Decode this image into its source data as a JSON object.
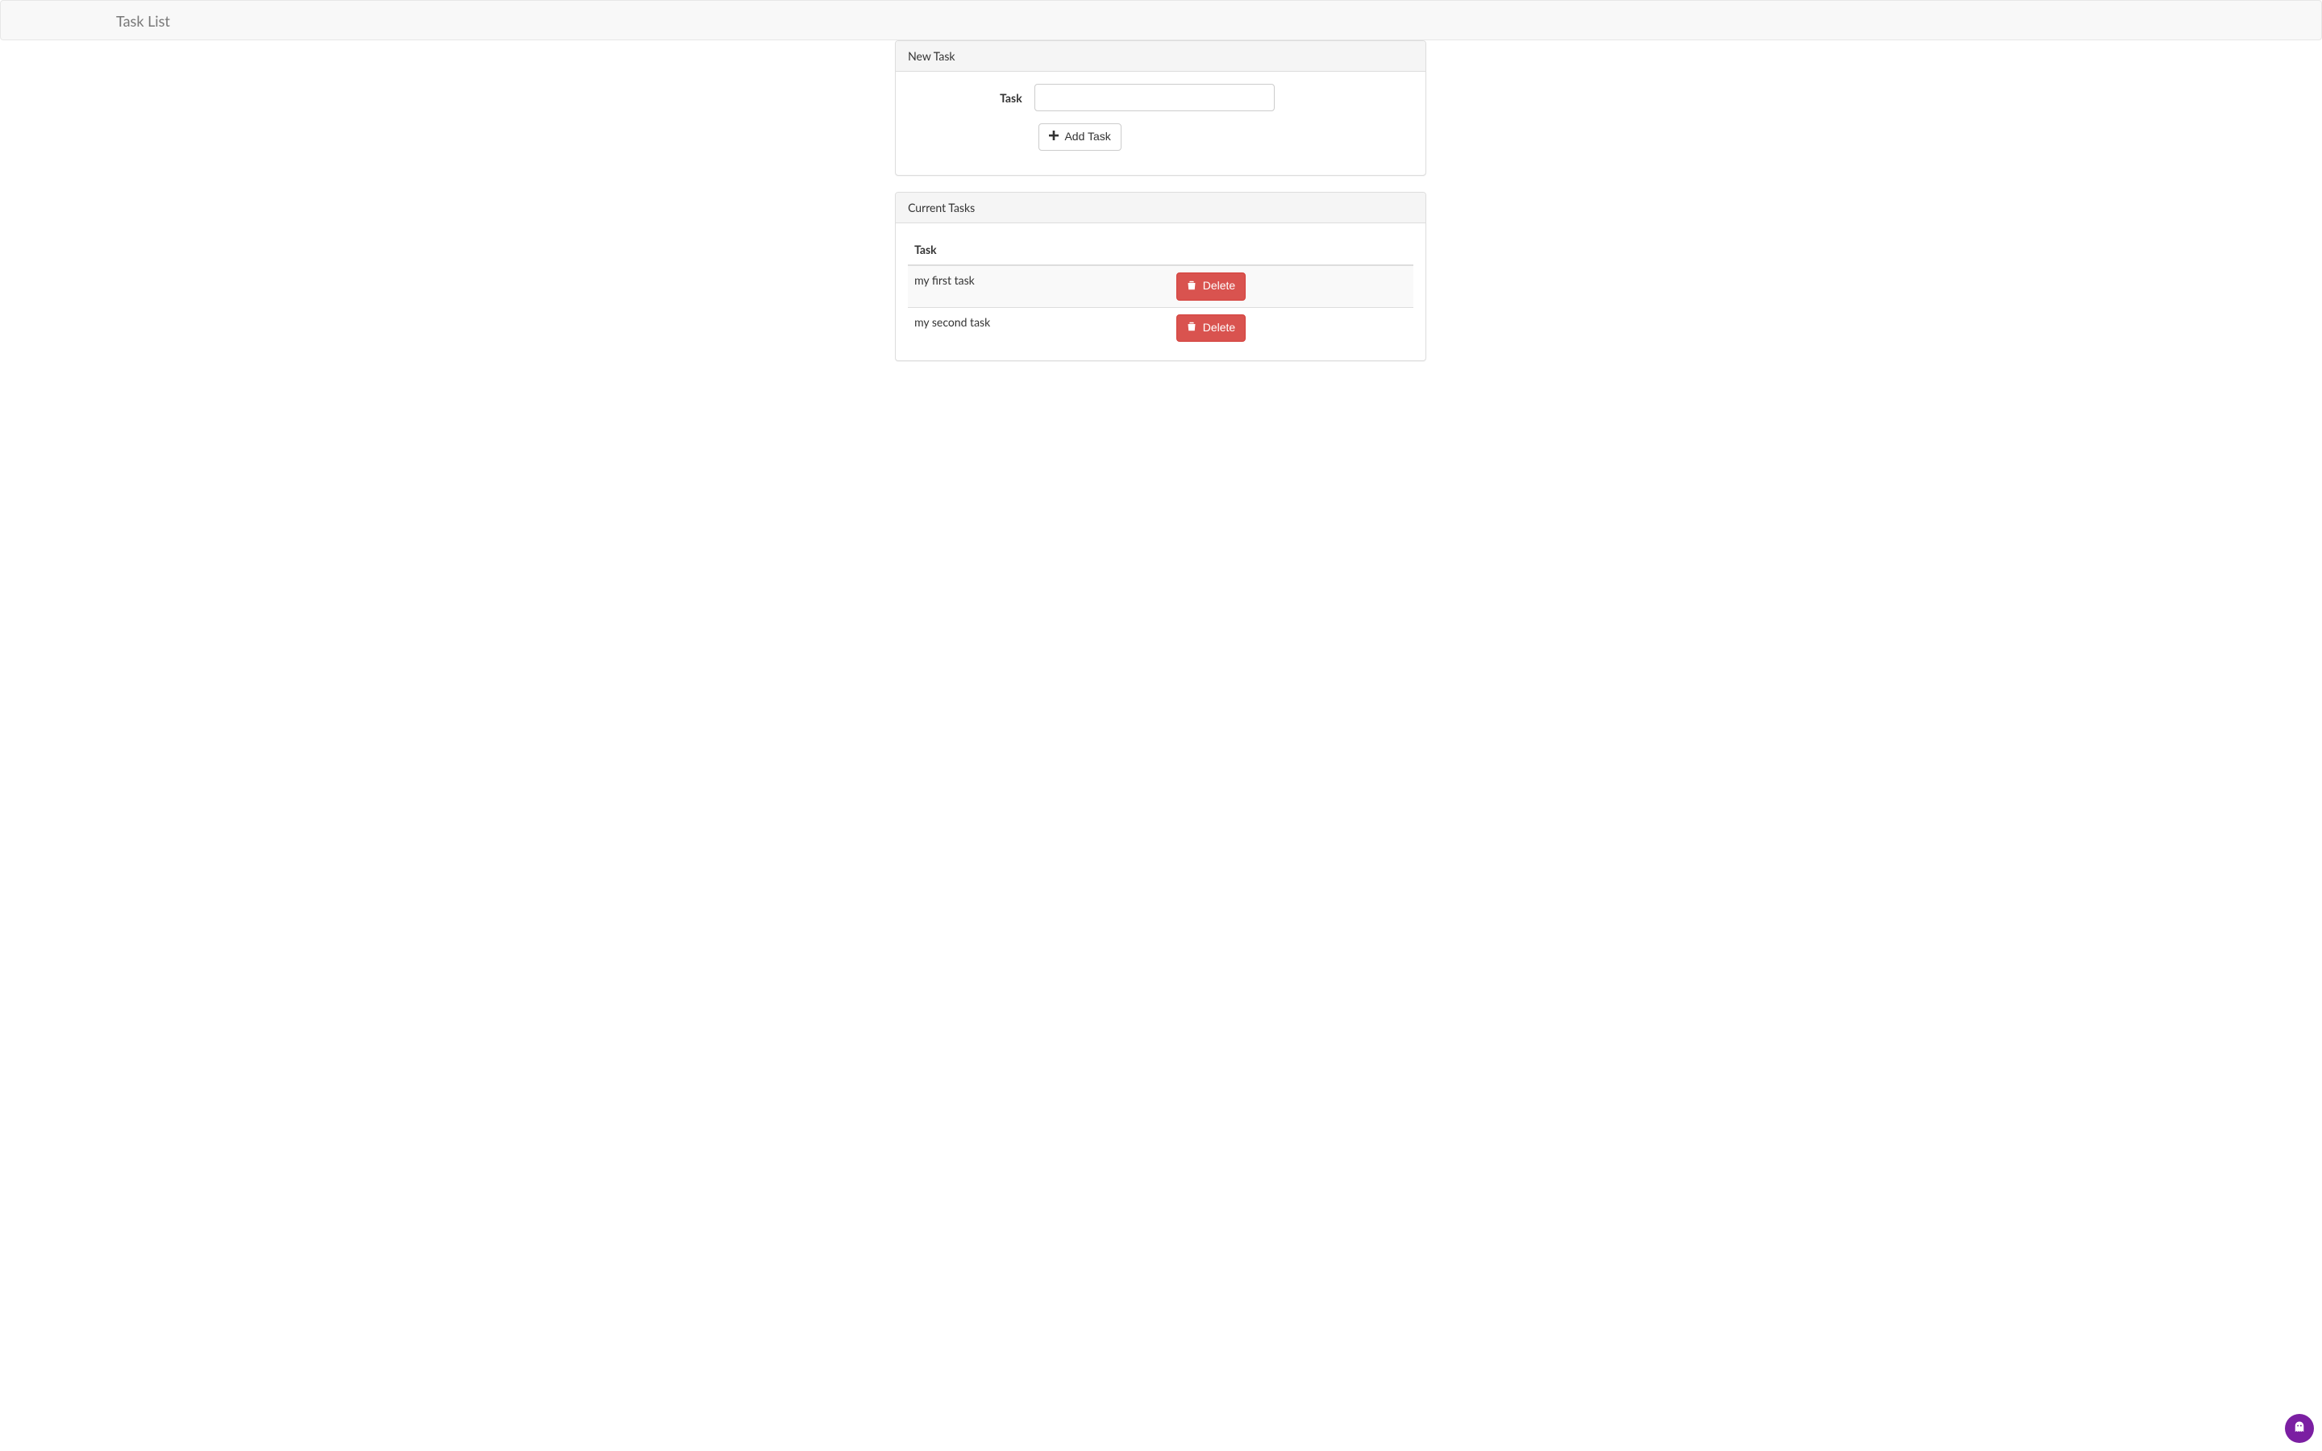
{
  "navbar": {
    "brand": "Task List"
  },
  "new_task_panel": {
    "heading": "New Task",
    "label": "Task",
    "input_value": "",
    "add_button": "Add Task"
  },
  "current_tasks_panel": {
    "heading": "Current Tasks",
    "column_header": "Task",
    "delete_label": "Delete",
    "tasks": [
      {
        "name": "my first task"
      },
      {
        "name": "my second task"
      }
    ]
  },
  "colors": {
    "danger": "#d9534f",
    "fab_bg": "#7b1fa2"
  }
}
